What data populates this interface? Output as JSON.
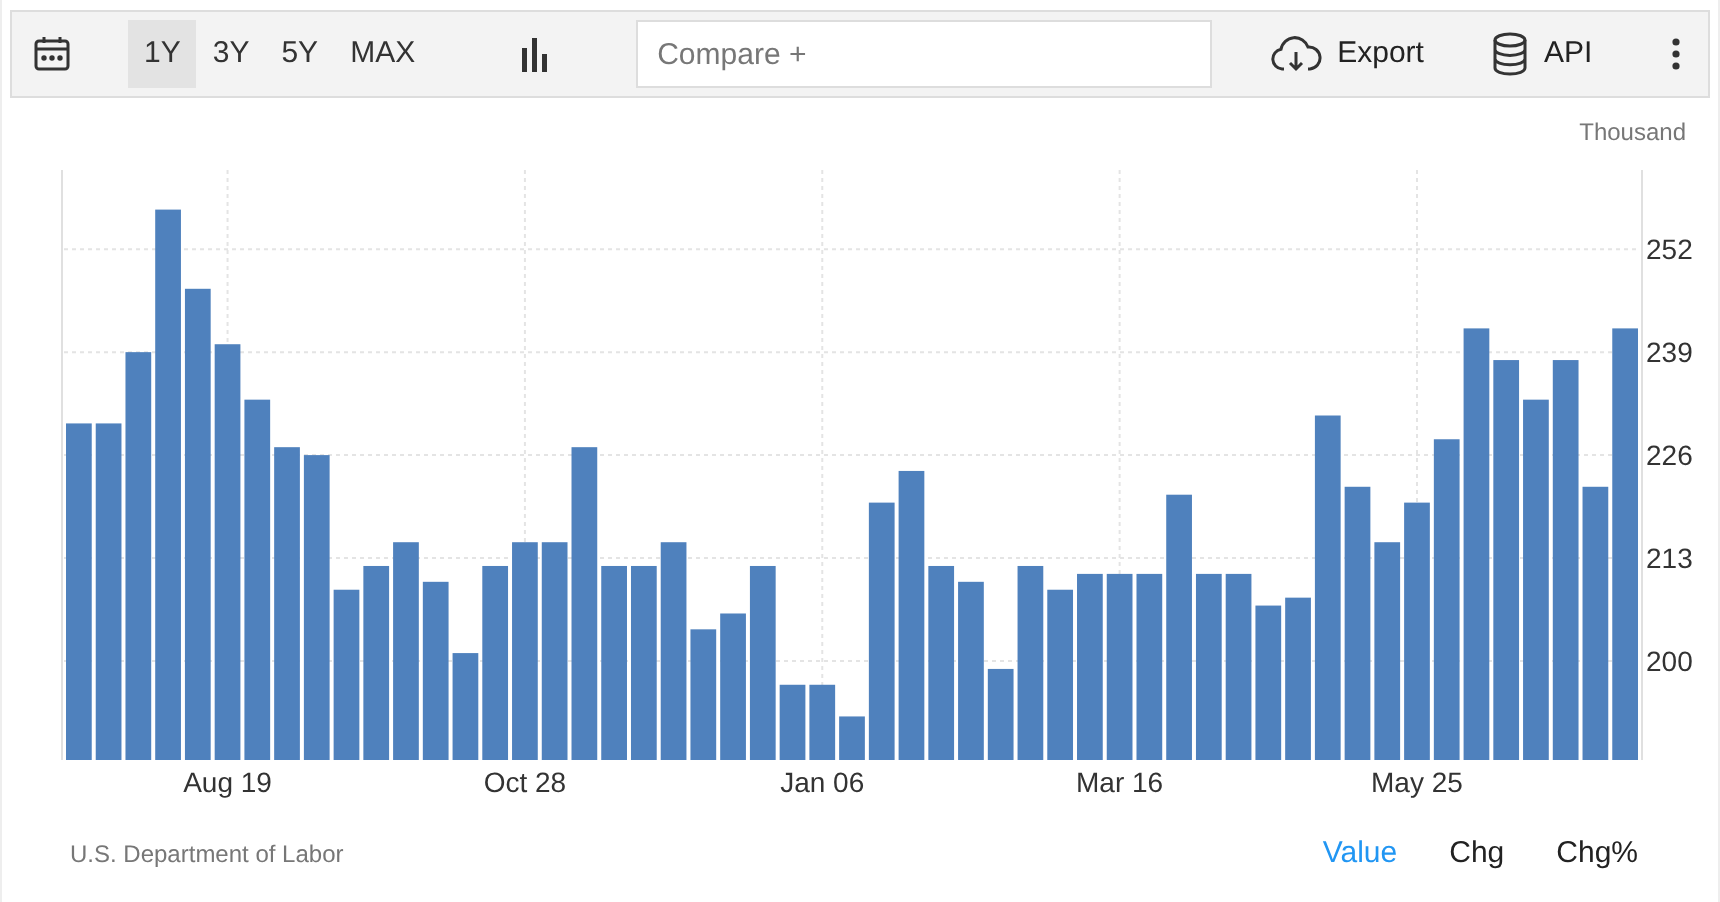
{
  "toolbar": {
    "ranges": [
      {
        "label": "1Y",
        "selected": true
      },
      {
        "label": "3Y",
        "selected": false
      },
      {
        "label": "5Y",
        "selected": false
      },
      {
        "label": "MAX",
        "selected": false
      }
    ],
    "compare": {
      "placeholder": "Compare +"
    },
    "export": "Export",
    "api": "API"
  },
  "unit": "Thousand",
  "chart_data": {
    "type": "bar",
    "grid": true,
    "categories": [
      null,
      null,
      null,
      null,
      null,
      "Aug 19",
      null,
      null,
      null,
      null,
      null,
      null,
      null,
      null,
      null,
      "Oct 28",
      null,
      null,
      null,
      null,
      null,
      null,
      null,
      null,
      null,
      "Jan 06",
      null,
      null,
      null,
      null,
      null,
      null,
      null,
      null,
      null,
      "Mar 16",
      null,
      null,
      null,
      null,
      null,
      null,
      null,
      null,
      null,
      "May 25",
      null,
      null,
      null,
      null,
      null,
      null,
      null
    ],
    "series": [
      {
        "color": "#4f81bd",
        "values": [
          230,
          230,
          239,
          257,
          247,
          240,
          233,
          227,
          226,
          209,
          212,
          215,
          210,
          201,
          212,
          215,
          215,
          227,
          212,
          212,
          215,
          204,
          206,
          212,
          197,
          197,
          193,
          220,
          224,
          212,
          210,
          199,
          212,
          209,
          211,
          211,
          211,
          221,
          211,
          211,
          207,
          208,
          231,
          222,
          215,
          220,
          228,
          242,
          238,
          233,
          238,
          222,
          242
        ]
      }
    ],
    "ylim": [
      187.5,
      262
    ],
    "yticks": [
      200,
      213,
      226,
      239,
      252
    ]
  },
  "source": "U.S. Department of Labor",
  "views": [
    {
      "label": "Value",
      "selected": true
    },
    {
      "label": "Chg",
      "selected": false
    },
    {
      "label": "Chg%",
      "selected": false
    }
  ]
}
